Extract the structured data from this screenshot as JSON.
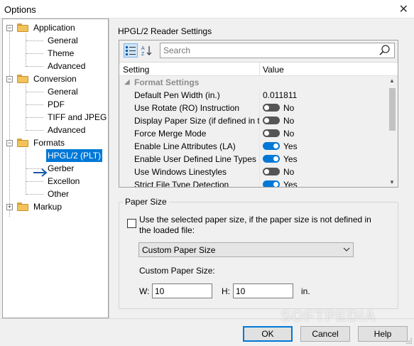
{
  "window": {
    "title": "Options",
    "close_glyph": "✕"
  },
  "tree": {
    "application": {
      "label": "Application",
      "children": [
        "General",
        "Theme",
        "Advanced"
      ]
    },
    "conversion": {
      "label": "Conversion",
      "children": [
        "General",
        "PDF",
        "TIFF and JPEG",
        "Advanced"
      ]
    },
    "formats": {
      "label": "Formats",
      "children": [
        "HPGL/2 (PLT)",
        "Gerber",
        "Excellon",
        "Other"
      ]
    },
    "markup": {
      "label": "Markup"
    },
    "expanded_glyph": "−",
    "collapsed_glyph": "+"
  },
  "section_title": "HPGL/2 Reader Settings",
  "property_grid": {
    "search_placeholder": "Search",
    "columns": {
      "setting": "Setting",
      "value": "Value"
    },
    "category": "Format Settings",
    "rows": [
      {
        "name": "Default Pen Width (in.)",
        "value": "0.011811"
      },
      {
        "name": "Use Rotate (RO) Instruction",
        "toggle": "off",
        "value": "No"
      },
      {
        "name": "Display Paper Size (if defined in th...",
        "toggle": "off",
        "value": "No"
      },
      {
        "name": "Force Merge Mode",
        "toggle": "off",
        "value": "No"
      },
      {
        "name": "Enable Line Attributes (LA)",
        "toggle": "on",
        "value": "Yes"
      },
      {
        "name": "Enable User Defined Line Types (...",
        "toggle": "on",
        "value": "Yes"
      },
      {
        "name": "Use Windows Linestyles",
        "toggle": "off",
        "value": "No"
      },
      {
        "name": "Strict File Type Detection",
        "toggle": "on",
        "value": "Yes"
      }
    ],
    "scroll_position": 0.0
  },
  "paper_size": {
    "group_title": "Paper Size",
    "checkbox_label": "Use the selected paper size, if the paper size is not defined in the loaded file:",
    "checkbox_checked": false,
    "combo_value": "Custom Paper Size",
    "custom_label": "Custom Paper Size:",
    "w_label": "W:",
    "w_value": "10",
    "h_label": "H:",
    "h_value": "10",
    "unit": "in."
  },
  "buttons": {
    "ok": "OK",
    "cancel": "Cancel",
    "help": "Help"
  },
  "watermark": "SOFTPEDIA",
  "colors": {
    "accent": "#0078d7",
    "toggle_off": "#555555",
    "folder": "#f2c35a"
  }
}
